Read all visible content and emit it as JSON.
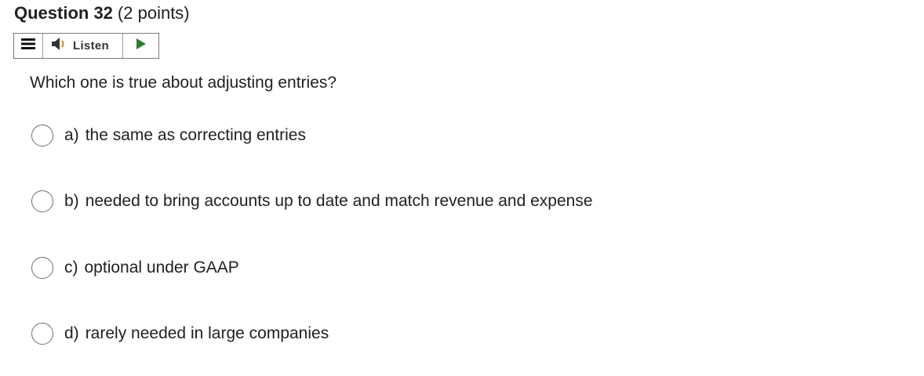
{
  "question": {
    "title": "Question 32",
    "points": "(2 points)",
    "prompt": "Which one is true about adjusting entries?"
  },
  "toolbar": {
    "listen_label": "Listen",
    "icons": {
      "menu": "menu-icon",
      "speaker": "speaker-icon",
      "play": "play-icon"
    },
    "play_color": "#2e7d32"
  },
  "choices": [
    {
      "letter": "a)",
      "text": "the same as correcting entries",
      "selected": false
    },
    {
      "letter": "b)",
      "text": "needed to bring accounts up to date and match revenue and expense",
      "selected": false
    },
    {
      "letter": "c)",
      "text": "optional under GAAP",
      "selected": false
    },
    {
      "letter": "d)",
      "text": "rarely needed in large companies",
      "selected": false
    }
  ]
}
